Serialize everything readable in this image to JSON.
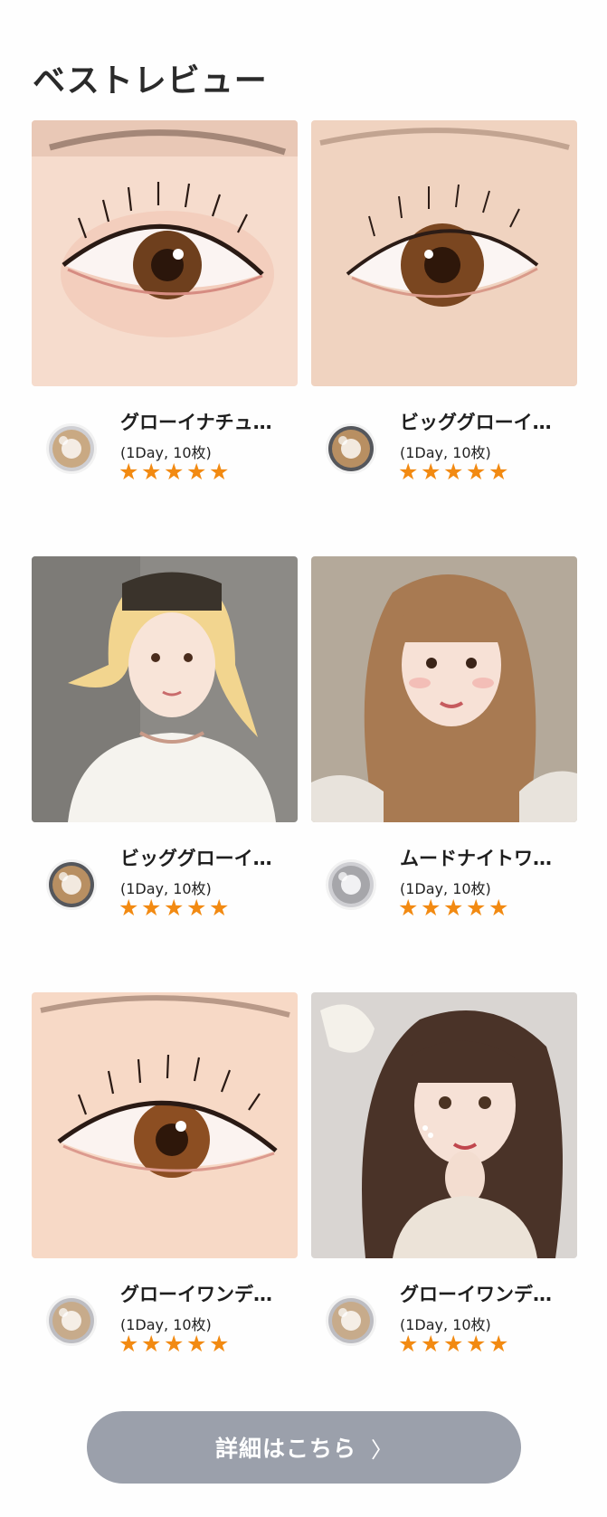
{
  "header": {
    "title": "ベストレビュー"
  },
  "reviews": [
    {
      "name": "グローイナチュ…",
      "spec": "(1Day, 10枚)",
      "rating": 5,
      "photo": "eye-closeup-photo",
      "lens_tone": "#c9a983"
    },
    {
      "name": "ビッググローイ…",
      "spec": "(1Day, 10枚)",
      "rating": 5,
      "photo": "eye-closeup-photo",
      "lens_tone": "#b88f62"
    },
    {
      "name": "ビッググローイ…",
      "spec": "(1Day, 10枚)",
      "rating": 5,
      "photo": "portrait-photo",
      "lens_tone": "#b88f62"
    },
    {
      "name": "ムードナイトワ…",
      "spec": "(1Day, 10枚)",
      "rating": 5,
      "photo": "portrait-photo",
      "lens_tone": "#a6a6aa"
    },
    {
      "name": "グローイワンデ…",
      "spec": "(1Day, 10枚)",
      "rating": 5,
      "photo": "eye-closeup-photo",
      "lens_tone": "#c7ab8b"
    },
    {
      "name": "グローイワンデ…",
      "spec": "(1Day, 10枚)",
      "rating": 5,
      "photo": "portrait-photo",
      "lens_tone": "#c7ab8b"
    }
  ],
  "star_glyph": "★",
  "star_color": "#f28a12",
  "cta": {
    "label": "詳細はこちら",
    "chevron": "〉",
    "color": "#9ba0ab"
  }
}
